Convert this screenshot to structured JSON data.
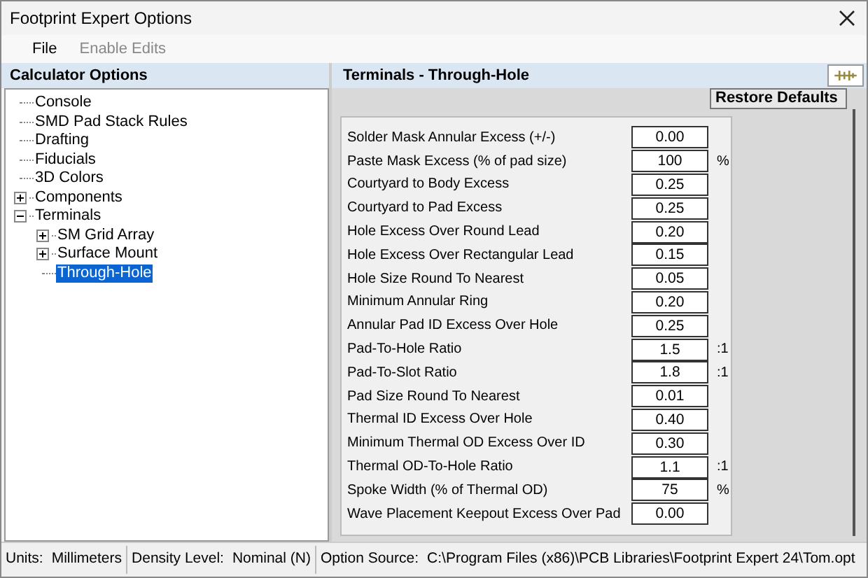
{
  "window": {
    "title": "Footprint Expert Options"
  },
  "menu": [
    {
      "label": "File",
      "disabled": false
    },
    {
      "label": "Enable Edits",
      "disabled": true
    }
  ],
  "sidebar": {
    "title": "Calculator Options",
    "items": [
      {
        "label": "Console",
        "selected": false
      },
      {
        "label": "SMD Pad Stack Rules",
        "selected": false
      },
      {
        "label": "Drafting",
        "selected": false
      },
      {
        "label": "Fiducials",
        "selected": false
      },
      {
        "label": "3D Colors",
        "selected": false
      },
      {
        "label": "Components",
        "selected": false,
        "expanded": false
      },
      {
        "label": "Terminals",
        "selected": false,
        "expanded": true,
        "children": [
          {
            "label": "SM Grid Array",
            "selected": false,
            "expanded": false
          },
          {
            "label": "Surface Mount",
            "selected": false,
            "expanded": false
          },
          {
            "label": "Through-Hole",
            "selected": true
          }
        ]
      }
    ]
  },
  "panel": {
    "title": "Terminals - Through-Hole",
    "restore_button": "Restore Defaults",
    "fields": [
      {
        "label": "Solder Mask Annular Excess (+/-)",
        "value": "0.00"
      },
      {
        "label": "Paste Mask Excess (% of pad size)",
        "value": "100",
        "unit": "%"
      },
      {
        "label": "Courtyard to Body Excess",
        "value": "0.25"
      },
      {
        "label": "Courtyard to Pad Excess",
        "value": "0.25"
      },
      {
        "label": "Hole Excess Over Round Lead",
        "value": "0.20"
      },
      {
        "label": "Hole Excess Over Rectangular Lead",
        "value": "0.15"
      },
      {
        "label": "Hole Size Round To Nearest",
        "value": "0.05"
      },
      {
        "label": "Minimum Annular Ring",
        "value": "0.20"
      },
      {
        "label": "Annular Pad ID Excess Over Hole",
        "value": "0.25"
      },
      {
        "label": "Pad-To-Hole Ratio",
        "value": "1.5",
        "unit": ":1"
      },
      {
        "label": "Pad-To-Slot Ratio",
        "value": "1.8",
        "unit": ":1"
      },
      {
        "label": "Pad Size Round To Nearest",
        "value": "0.01"
      },
      {
        "label": "Thermal ID Excess Over Hole",
        "value": "0.40"
      },
      {
        "label": "Minimum Thermal OD Excess Over ID",
        "value": "0.30"
      },
      {
        "label": "Thermal OD-To-Hole Ratio",
        "value": "1.1",
        "unit": ":1"
      },
      {
        "label": "Spoke Width (% of Thermal OD)",
        "value": "75",
        "unit": "%"
      },
      {
        "label": "Wave Placement Keepout Excess Over Pad",
        "value": "0.00"
      }
    ]
  },
  "status_bar": [
    {
      "label": "Units:",
      "value": "Millimeters"
    },
    {
      "label": "Density Level:",
      "value": "Nominal (N)"
    },
    {
      "label": "Option Source:",
      "value": "C:\\Program Files (x86)\\PCB Libraries\\Footprint Expert 24\\Tom.opt"
    }
  ]
}
